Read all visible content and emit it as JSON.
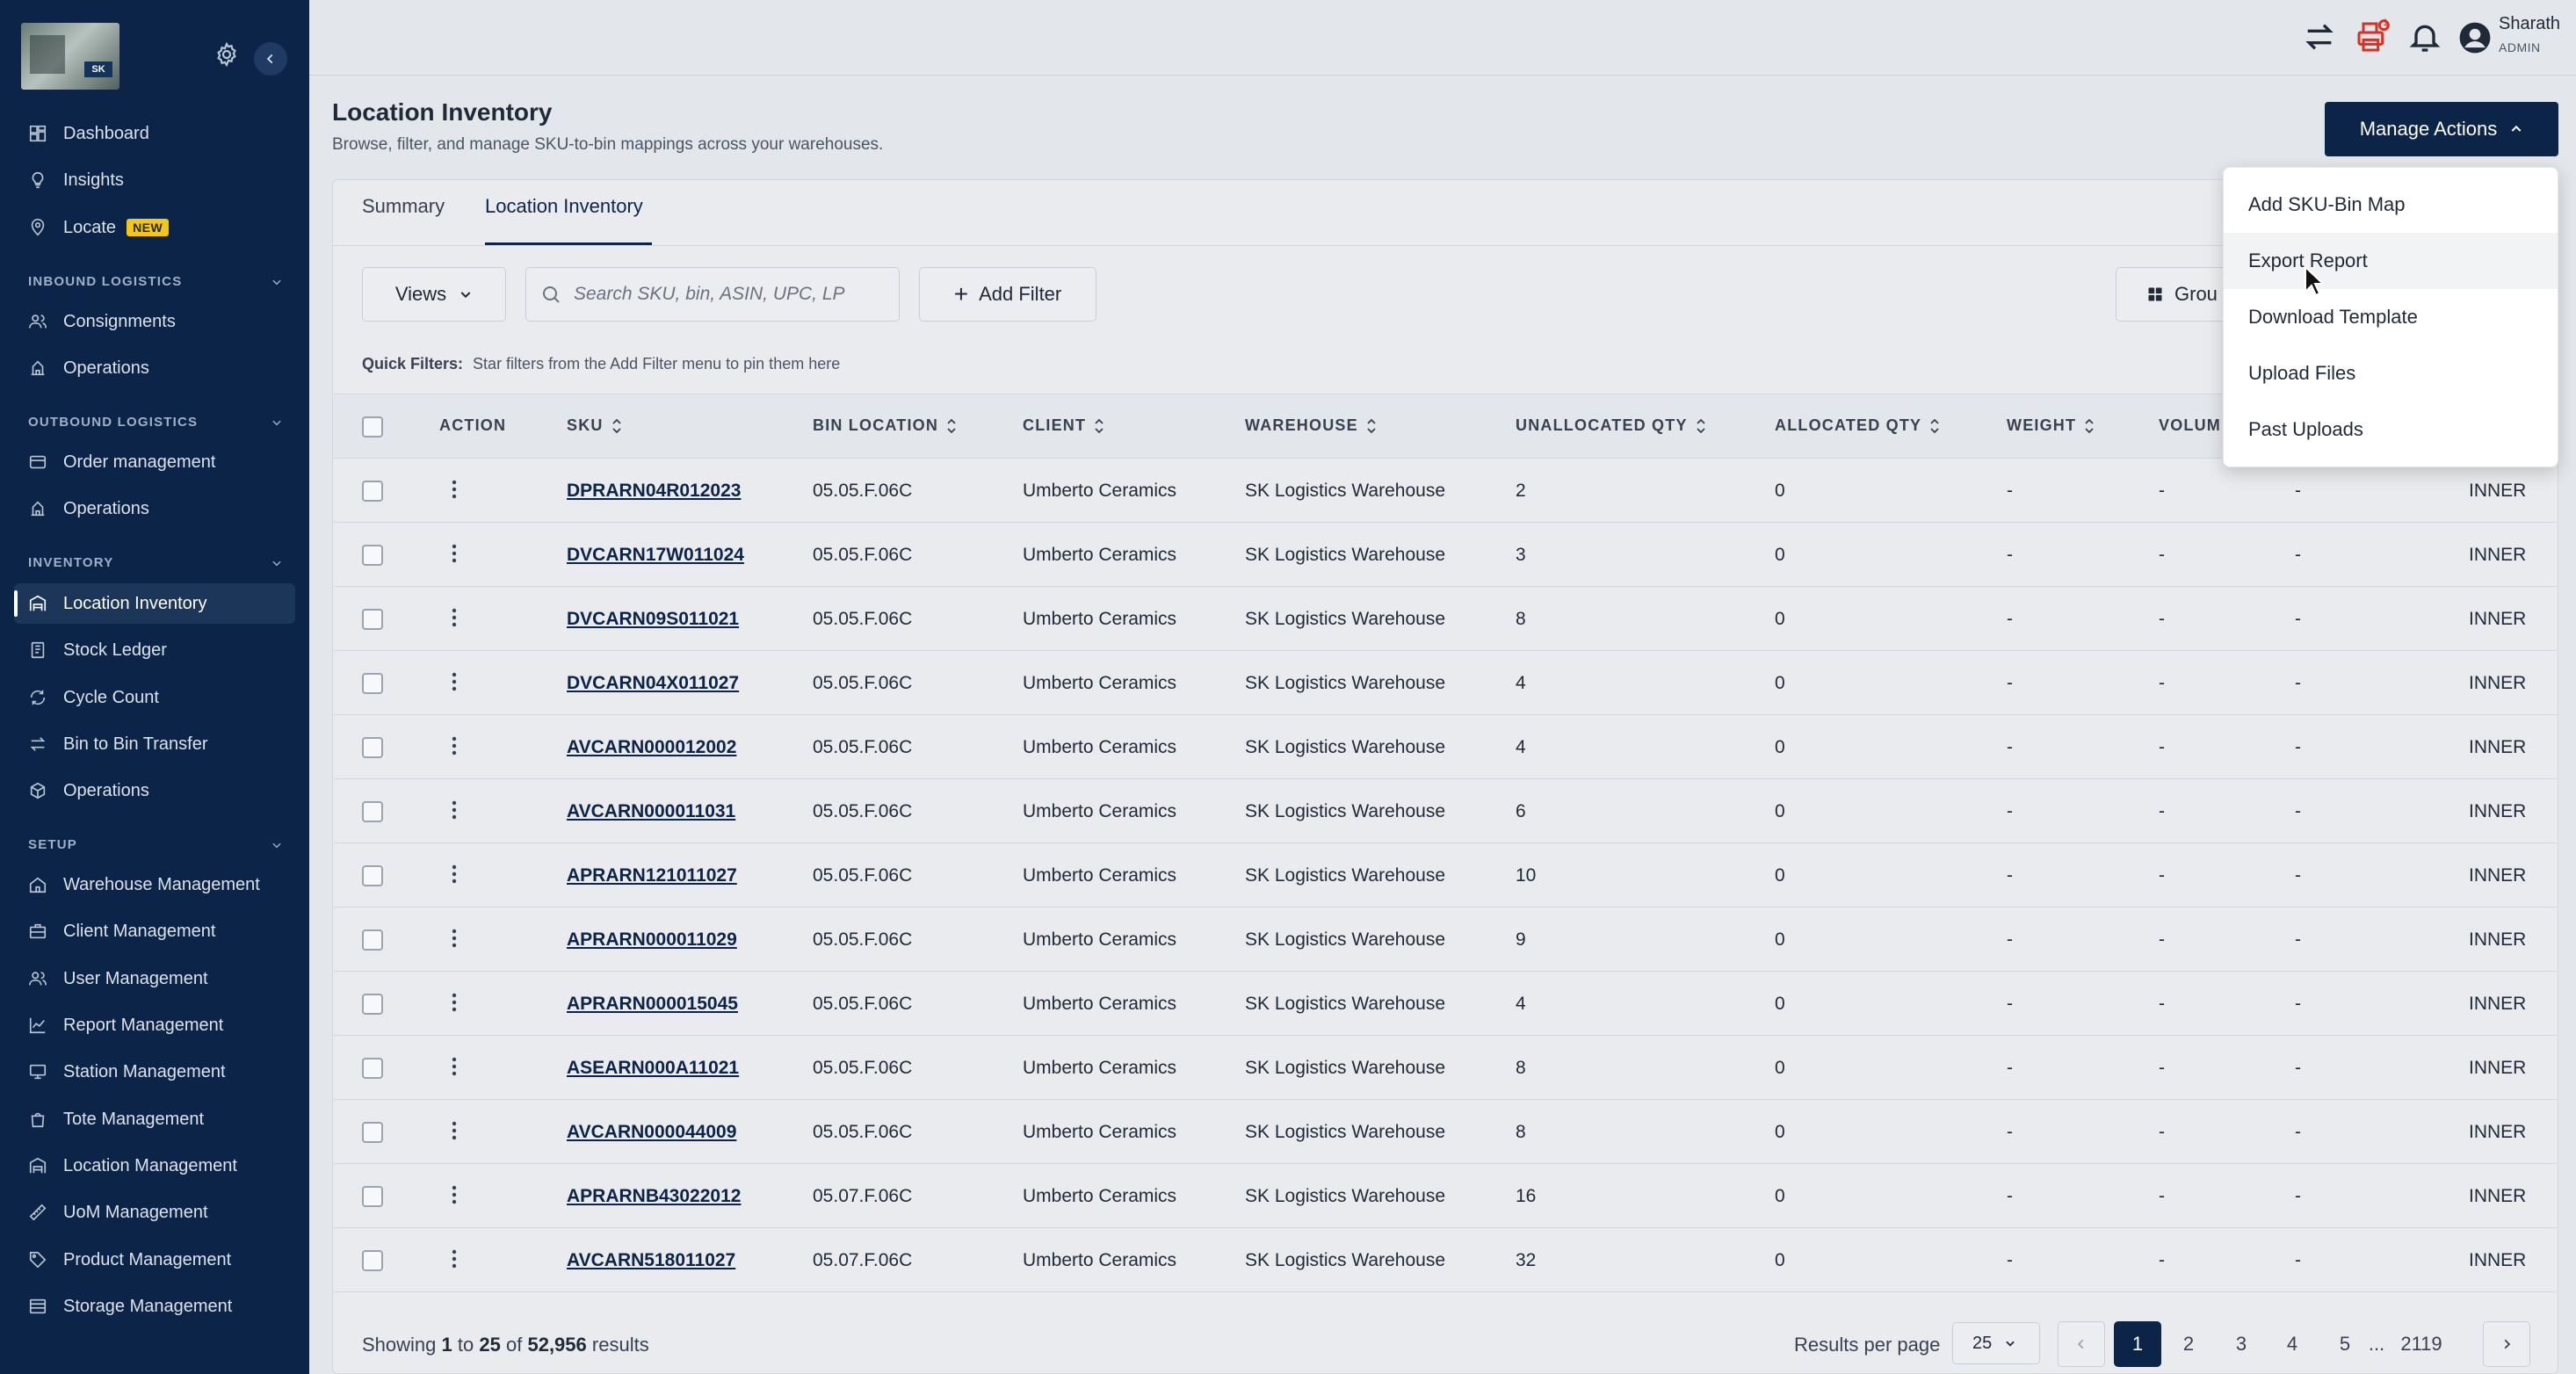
{
  "sidebar": {
    "nav": {
      "dashboard": "Dashboard",
      "insights": "Insights",
      "locate": "Locate",
      "locate_badge": "NEW"
    },
    "sections": {
      "inbound": "INBOUND LOGISTICS",
      "outbound": "OUTBOUND LOGISTICS",
      "inventory": "INVENTORY",
      "setup": "SETUP"
    },
    "inbound_items": [
      "Consignments",
      "Operations"
    ],
    "outbound_items": [
      "Order management",
      "Operations"
    ],
    "inventory_items": [
      "Location Inventory",
      "Stock Ledger",
      "Cycle Count",
      "Bin to Bin Transfer",
      "Operations"
    ],
    "setup_items": [
      "Warehouse Management",
      "Client Management",
      "User Management",
      "Report Management",
      "Station Management",
      "Tote Management",
      "Location Management",
      "UoM Management",
      "Product Management",
      "Storage Management"
    ],
    "logo_text": "SK"
  },
  "topbar": {
    "user_name": "Sharath",
    "user_role": "ADMIN",
    "print_badge": "1"
  },
  "page": {
    "title": "Location Inventory",
    "subtitle": "Browse, filter, and manage SKU-to-bin mappings across your warehouses.",
    "manage_actions": "Manage Actions"
  },
  "tabs": [
    "Summary",
    "Location Inventory"
  ],
  "toolbar": {
    "views": "Views",
    "search_placeholder": "Search SKU, bin, ASIN, UPC, LP",
    "add_filter": "Add Filter",
    "group": "Grou"
  },
  "quick_filters": {
    "label": "Quick Filters:",
    "hint": "Star filters from the Add Filter menu to pin them here"
  },
  "table": {
    "headers": [
      "ACTION",
      "SKU",
      "BIN LOCATION",
      "CLIENT",
      "WAREHOUSE",
      "UNALLOCATED QTY",
      "ALLOCATED QTY",
      "WEIGHT",
      "VOLUM"
    ],
    "rows": [
      {
        "sku": "DPRARN04R012023",
        "bin": "05.05.F.06C",
        "client": "Umberto Ceramics",
        "warehouse": "SK Logistics Warehouse",
        "unalloc": "2",
        "alloc": "0",
        "weight": "-",
        "volume": "-",
        "extra": "-",
        "uom": "INNER"
      },
      {
        "sku": "DVCARN17W011024",
        "bin": "05.05.F.06C",
        "client": "Umberto Ceramics",
        "warehouse": "SK Logistics Warehouse",
        "unalloc": "3",
        "alloc": "0",
        "weight": "-",
        "volume": "-",
        "extra": "-",
        "uom": "INNER"
      },
      {
        "sku": "DVCARN09S011021",
        "bin": "05.05.F.06C",
        "client": "Umberto Ceramics",
        "warehouse": "SK Logistics Warehouse",
        "unalloc": "8",
        "alloc": "0",
        "weight": "-",
        "volume": "-",
        "extra": "-",
        "uom": "INNER"
      },
      {
        "sku": "DVCARN04X011027",
        "bin": "05.05.F.06C",
        "client": "Umberto Ceramics",
        "warehouse": "SK Logistics Warehouse",
        "unalloc": "4",
        "alloc": "0",
        "weight": "-",
        "volume": "-",
        "extra": "-",
        "uom": "INNER"
      },
      {
        "sku": "AVCARN000012002",
        "bin": "05.05.F.06C",
        "client": "Umberto Ceramics",
        "warehouse": "SK Logistics Warehouse",
        "unalloc": "4",
        "alloc": "0",
        "weight": "-",
        "volume": "-",
        "extra": "-",
        "uom": "INNER"
      },
      {
        "sku": "AVCARN000011031",
        "bin": "05.05.F.06C",
        "client": "Umberto Ceramics",
        "warehouse": "SK Logistics Warehouse",
        "unalloc": "6",
        "alloc": "0",
        "weight": "-",
        "volume": "-",
        "extra": "-",
        "uom": "INNER"
      },
      {
        "sku": "APRARN121011027",
        "bin": "05.05.F.06C",
        "client": "Umberto Ceramics",
        "warehouse": "SK Logistics Warehouse",
        "unalloc": "10",
        "alloc": "0",
        "weight": "-",
        "volume": "-",
        "extra": "-",
        "uom": "INNER"
      },
      {
        "sku": "APRARN000011029",
        "bin": "05.05.F.06C",
        "client": "Umberto Ceramics",
        "warehouse": "SK Logistics Warehouse",
        "unalloc": "9",
        "alloc": "0",
        "weight": "-",
        "volume": "-",
        "extra": "-",
        "uom": "INNER"
      },
      {
        "sku": "APRARN000015045",
        "bin": "05.05.F.06C",
        "client": "Umberto Ceramics",
        "warehouse": "SK Logistics Warehouse",
        "unalloc": "4",
        "alloc": "0",
        "weight": "-",
        "volume": "-",
        "extra": "-",
        "uom": "INNER"
      },
      {
        "sku": "ASEARN000A11021",
        "bin": "05.05.F.06C",
        "client": "Umberto Ceramics",
        "warehouse": "SK Logistics Warehouse",
        "unalloc": "8",
        "alloc": "0",
        "weight": "-",
        "volume": "-",
        "extra": "-",
        "uom": "INNER"
      },
      {
        "sku": "AVCARN000044009",
        "bin": "05.05.F.06C",
        "client": "Umberto Ceramics",
        "warehouse": "SK Logistics Warehouse",
        "unalloc": "8",
        "alloc": "0",
        "weight": "-",
        "volume": "-",
        "extra": "-",
        "uom": "INNER"
      },
      {
        "sku": "APRARNB43022012",
        "bin": "05.07.F.06C",
        "client": "Umberto Ceramics",
        "warehouse": "SK Logistics Warehouse",
        "unalloc": "16",
        "alloc": "0",
        "weight": "-",
        "volume": "-",
        "extra": "-",
        "uom": "INNER"
      },
      {
        "sku": "AVCARN518011027",
        "bin": "05.07.F.06C",
        "client": "Umberto Ceramics",
        "warehouse": "SK Logistics Warehouse",
        "unalloc": "32",
        "alloc": "0",
        "weight": "-",
        "volume": "-",
        "extra": "-",
        "uom": "INNER"
      }
    ]
  },
  "footer": {
    "showing": "Showing",
    "from": "1",
    "to_word": "to",
    "to": "25",
    "of_word": "of",
    "total": "52,956",
    "results_word": "results",
    "rpp_label": "Results per page",
    "rpp_value": "25",
    "pages": [
      "1",
      "2",
      "3",
      "4",
      "5",
      "...",
      "2119"
    ]
  },
  "menu": {
    "items": [
      "Add SKU-Bin Map",
      "Export Report",
      "Download Template",
      "Upload Files",
      "Past Uploads"
    ]
  },
  "colors": {
    "sidebar_bg": "#0c2447",
    "accent": "#0c2447",
    "badge_new": "#f5c518",
    "alert": "#d93025"
  }
}
